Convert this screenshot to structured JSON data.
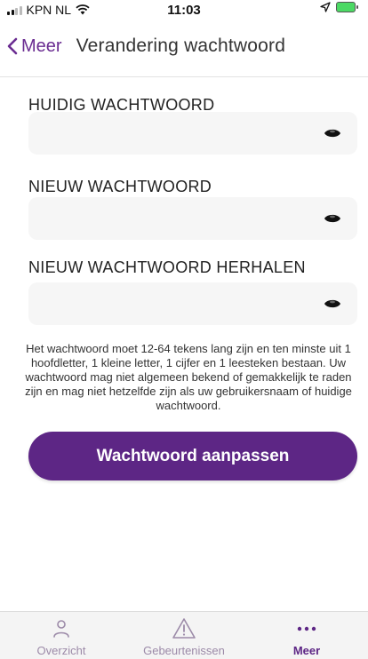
{
  "status_bar": {
    "carrier": "KPN NL",
    "time": "11:03"
  },
  "nav": {
    "back_label": "Meer",
    "title": "Verandering wachtwoord"
  },
  "form": {
    "fields": [
      {
        "label": "HUIDIG WACHTWOORD",
        "value": "",
        "placeholder": ""
      },
      {
        "label": "NIEUW WACHTWOORD",
        "value": "",
        "placeholder": ""
      },
      {
        "label": "NIEUW WACHTWOORD HERHALEN",
        "value": "",
        "placeholder": ""
      }
    ],
    "hint": "Het wachtwoord moet 12-64 tekens lang zijn en ten minste uit 1 hoofdletter, 1 kleine letter, 1 cijfer en 1 leesteken bestaan. Uw wachtwoord mag niet algemeen bekend of gemakkelijk te raden zijn en mag niet hetzelfde zijn als uw gebruikersnaam of huidige wachtwoord.",
    "submit_label": "Wachtwoord aanpassen"
  },
  "tab_bar": {
    "tabs": [
      {
        "label": "Overzicht",
        "icon": "person-icon",
        "active": false
      },
      {
        "label": "Gebeurtenissen",
        "icon": "warning-icon",
        "active": false
      },
      {
        "label": "Meer",
        "icon": "more-dots-icon",
        "active": true
      }
    ]
  },
  "colors": {
    "brand_purple": "#5d2685",
    "inactive_tab": "#9c8aa8",
    "field_background": "#f6f6f6"
  }
}
